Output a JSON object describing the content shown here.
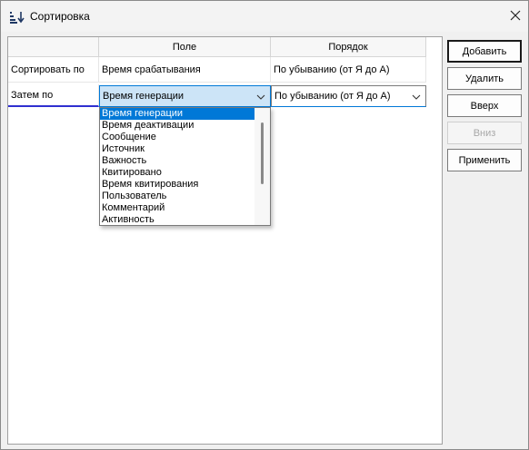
{
  "window": {
    "title": "Сортировка",
    "title_icon": "sort-descending-icon",
    "close_icon": "close-icon"
  },
  "grid": {
    "columns": [
      "",
      "Поле",
      "Порядок"
    ],
    "rows": [
      {
        "label": "Сортировать по",
        "field": "Время срабатывания",
        "order": "По убыванию (от Я до А)"
      },
      {
        "label": "Затем по",
        "field": "Время генерации",
        "order": "По убыванию (от Я до А)"
      }
    ]
  },
  "field_dropdown": {
    "selected_index": 0,
    "options": [
      "Время генерации",
      "Время деактивации",
      "Сообщение",
      "Источник",
      "Важность",
      "Квитировано",
      "Время квитирования",
      "Пользователь",
      "Комментарий",
      "Активность"
    ]
  },
  "buttons": {
    "add": "Добавить",
    "delete": "Удалить",
    "up": "Вверх",
    "down": "Вниз",
    "apply": "Применить"
  }
}
